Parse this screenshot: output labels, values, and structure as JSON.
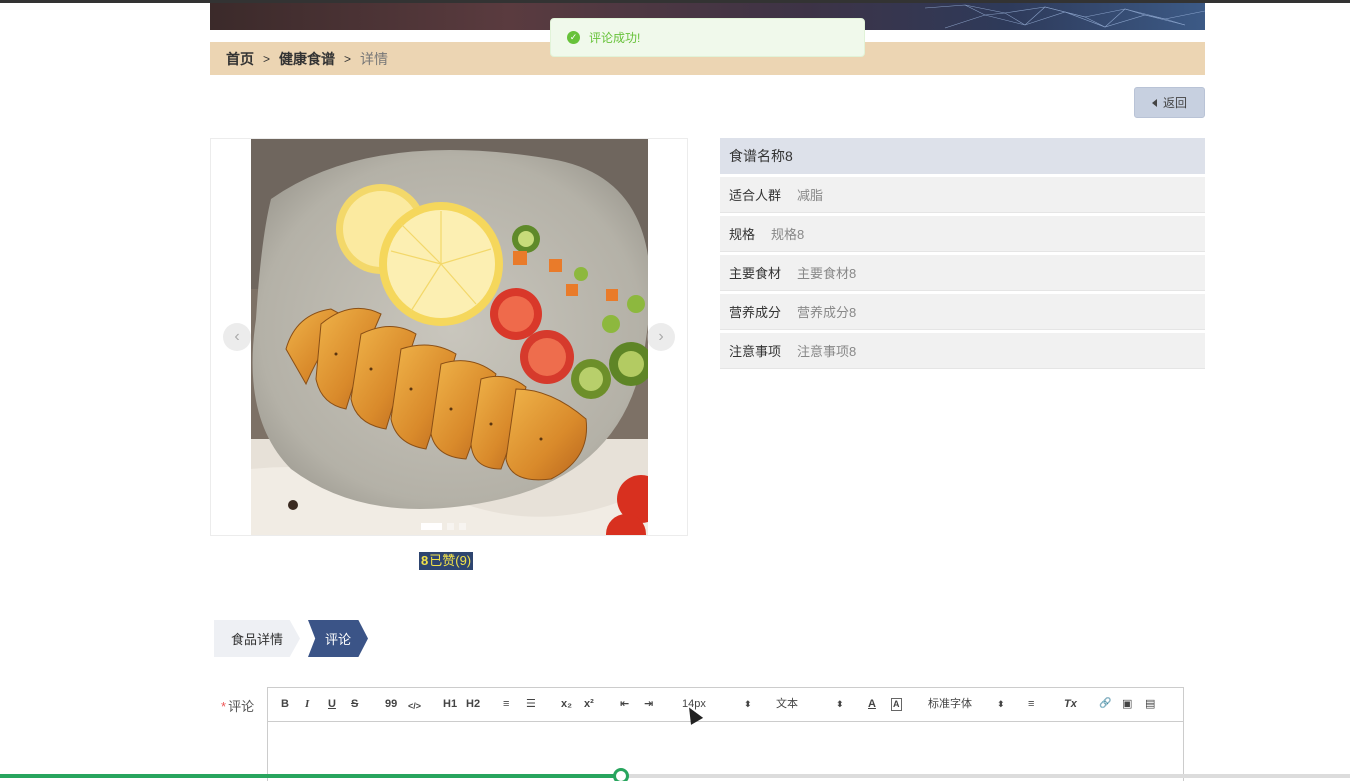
{
  "toast": {
    "message": "评论成功!",
    "icon": "check-circle-icon"
  },
  "breadcrumb": {
    "home": "首页",
    "section": "健康食谱",
    "current": "详情",
    "separator": ">"
  },
  "back_button": {
    "label": "返回",
    "icon": "caret-left-icon"
  },
  "carousel": {
    "prev_icon": "chevron-left-icon",
    "next_icon": "chevron-right-icon",
    "prev": "‹",
    "next": "›",
    "slides": 3,
    "active_slide": 1
  },
  "like": {
    "icon": "thumbs-up-icon",
    "glyph": "8",
    "label": "已赞(9)"
  },
  "recipe": {
    "title": "食谱名称8",
    "fields": [
      {
        "key": "适合人群",
        "value": "减脂"
      },
      {
        "key": "规格",
        "value": "规格8"
      },
      {
        "key": "主要食材",
        "value": "主要食材8"
      },
      {
        "key": "营养成分",
        "value": "营养成分8"
      },
      {
        "key": "注意事项",
        "value": "注意事项8"
      }
    ]
  },
  "tabs": [
    {
      "label": "食品详情",
      "active": false
    },
    {
      "label": "评论",
      "active": true
    }
  ],
  "comment": {
    "required_mark": "*",
    "label": "评论",
    "toolbar": {
      "bold": "B",
      "italic": "I",
      "underline": "U",
      "strike": "S",
      "quote": "99",
      "code": "</>",
      "h1": "H1",
      "h2": "H2",
      "ordered_list": "≡",
      "bullet_list": "☰",
      "sub": "x₂",
      "sup": "x²",
      "outdent": "⇤",
      "indent": "⇥",
      "size": "14px",
      "header": "文本",
      "color": "A",
      "background": "A",
      "font": "标准字体",
      "align": "≡",
      "clean": "Tx",
      "link": "🔗",
      "image": "▣",
      "video": "▤"
    }
  },
  "progress": {
    "value": 0.46,
    "color": "#28a55e"
  },
  "colors": {
    "breadcrumb_bg": "#ecd5b3",
    "tab_active": "#3b5487",
    "like_bg": "#2e4570",
    "toast_green": "#67c23a"
  }
}
